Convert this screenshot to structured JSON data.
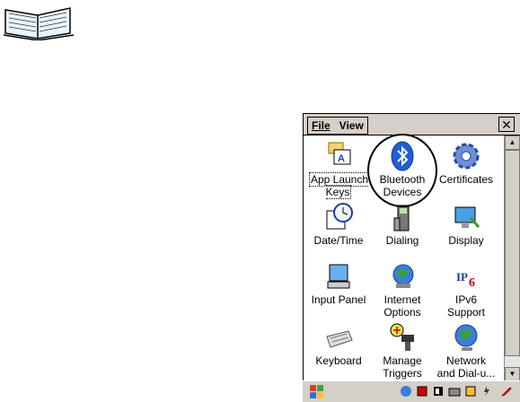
{
  "menu": {
    "file": "File",
    "view": "View",
    "close": "✕"
  },
  "items": [
    {
      "label": "App Launch\nKeys",
      "icon": "app-launch-keys-icon"
    },
    {
      "label": "Bluetooth\nDevices",
      "icon": "bluetooth-icon"
    },
    {
      "label": "Certificates",
      "icon": "certificates-gear-icon"
    },
    {
      "label": "Date/Time",
      "icon": "date-time-icon"
    },
    {
      "label": "Dialing",
      "icon": "dialing-phone-icon"
    },
    {
      "label": "Display",
      "icon": "display-icon"
    },
    {
      "label": "Input Panel",
      "icon": "input-panel-icon"
    },
    {
      "label": "Internet\nOptions",
      "icon": "internet-options-icon"
    },
    {
      "label": "IPv6\nSupport",
      "icon": "ipv6-icon"
    },
    {
      "label": "Keyboard",
      "icon": "keyboard-icon"
    },
    {
      "label": "Manage\nTriggers",
      "icon": "manage-triggers-icon"
    },
    {
      "label": "Network\nand Dial-u...",
      "icon": "network-icon"
    }
  ],
  "colors": {
    "chrome": "#d4d0c8",
    "bluetooth": "#1f5fd6"
  }
}
